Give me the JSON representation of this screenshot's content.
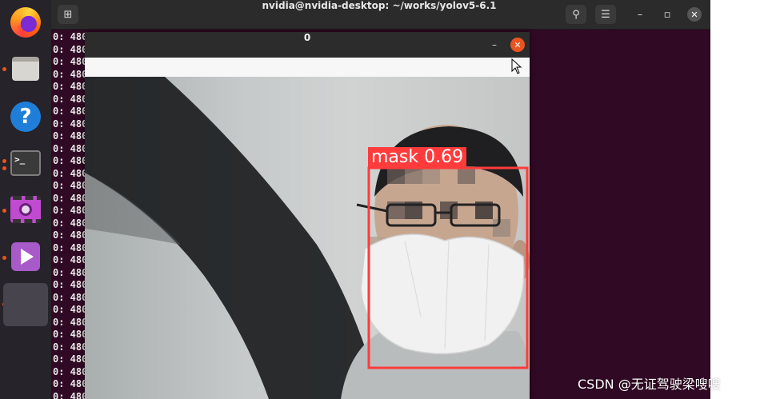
{
  "terminal": {
    "title": "nvidia@nvidia-desktop: ~/works/yolov5-6.1",
    "line_text": "0: 480",
    "line_count": 30,
    "newtab_glyph": "⊞",
    "search_glyph": "⚲",
    "menu_glyph": "☰",
    "min_glyph": "–",
    "max_glyph": "▫",
    "close_glyph": "✕"
  },
  "dock": {
    "icons": [
      "firefox-icon",
      "files-icon",
      "help-icon",
      "terminal-icon",
      "video-icon",
      "media-player-icon"
    ],
    "help_glyph": "?",
    "term_glyph": ">_"
  },
  "cv_window": {
    "title": "0",
    "min_glyph": "–",
    "close_glyph": "✕",
    "detection": {
      "label": "mask 0.69",
      "color": "#ff3b3b"
    }
  },
  "watermark": "CSDN @无证驾驶梁嗖嗖",
  "colors": {
    "desktop": "#2c001e",
    "terminal_bg": "#300a24",
    "accent": "#e95420"
  }
}
